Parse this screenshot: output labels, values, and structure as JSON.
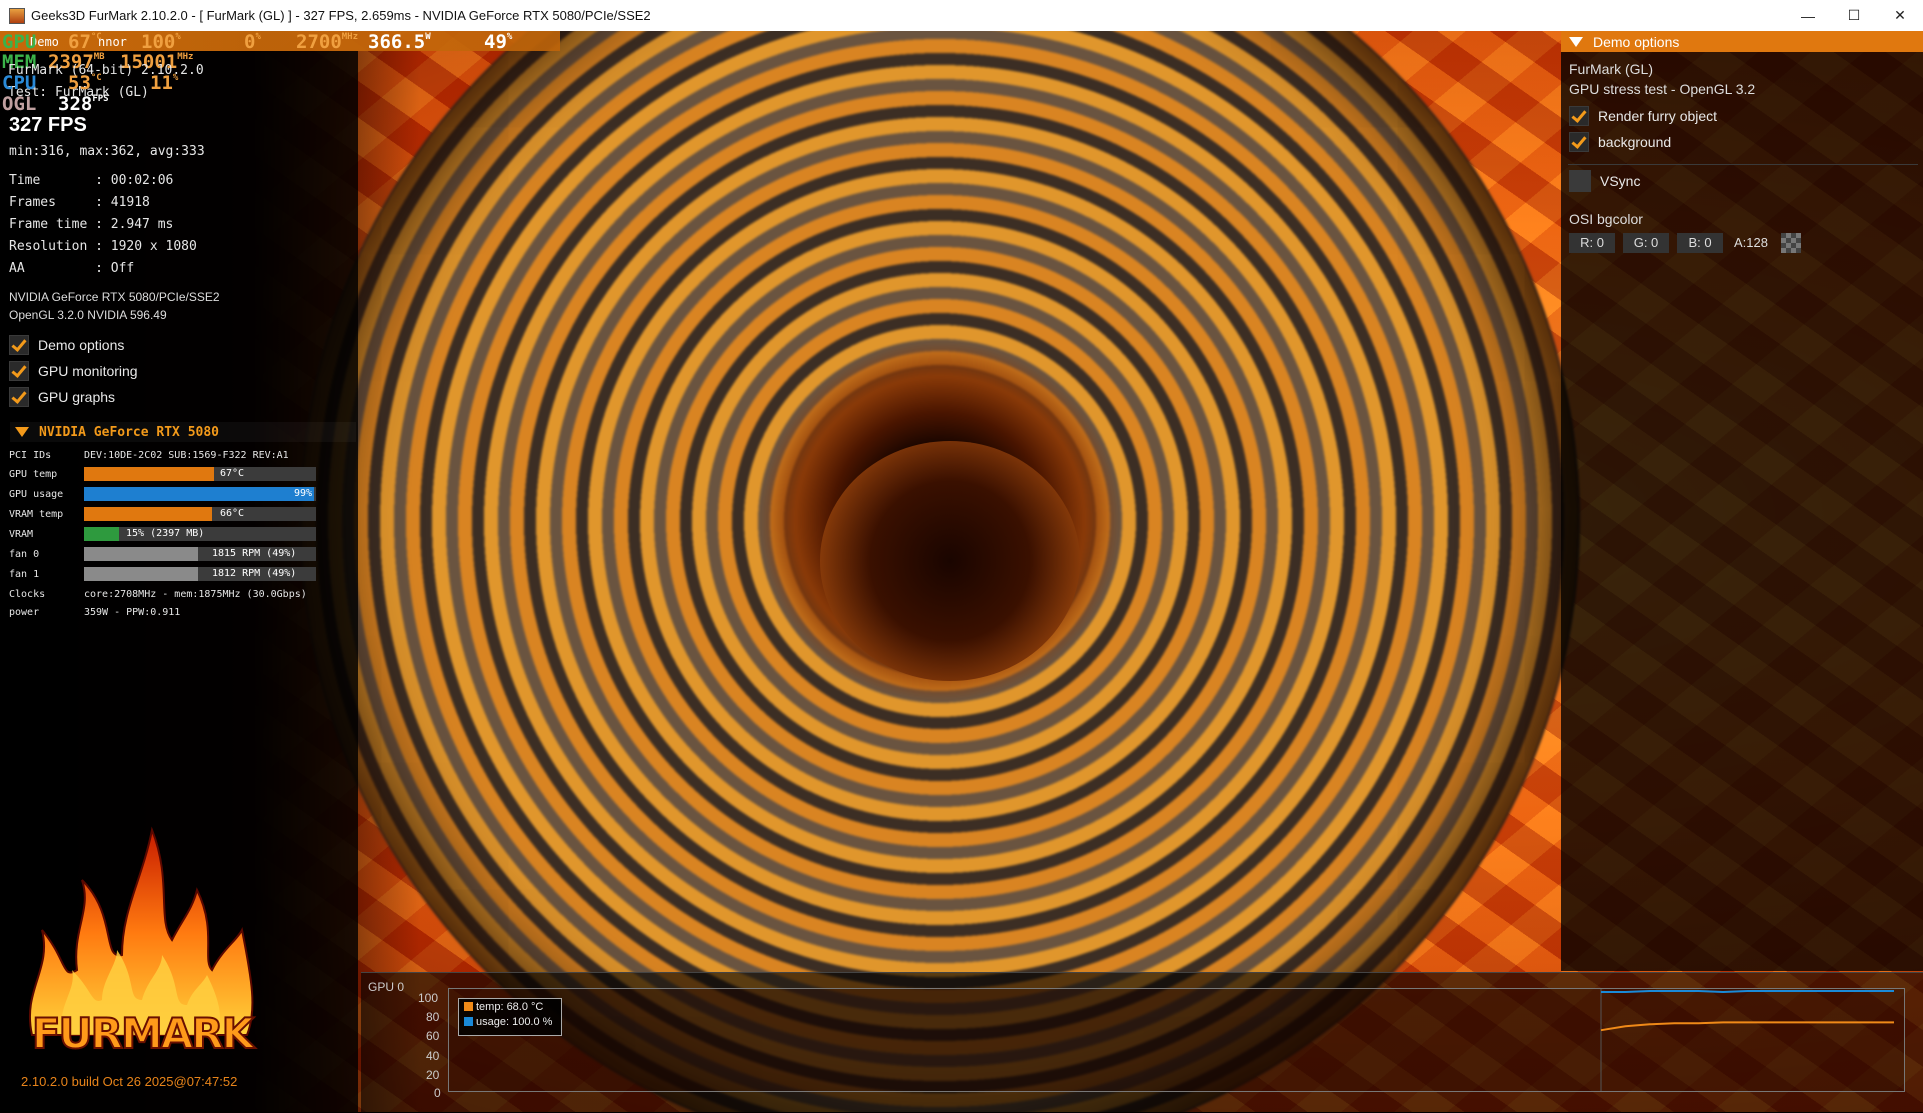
{
  "window": {
    "title": "Geeks3D FurMark 2.10.2.0 - [ FurMark (GL) ] - 327 FPS, 2.659ms - NVIDIA GeForce RTX 5080/PCIe/SSE2",
    "minimize": "—",
    "maximize": "☐",
    "close": "✕"
  },
  "osd": {
    "gpu_label": "GPU",
    "gpu_temp": "67",
    "gpu_temp_unit": "°C",
    "gpu_usage": "100",
    "gpu_usage_unit": "%",
    "gpu_x": "0",
    "gpu_x_unit": "%",
    "gpu_clock": "2700",
    "gpu_clock_unit": "MHz",
    "gpu_power": "366.5",
    "gpu_power_unit": "W",
    "gpu_fan": "49",
    "gpu_fan_unit": "%",
    "mem_label": "MEM",
    "mem_used": "2397",
    "mem_used_unit": "MB",
    "mem_clock": "15001",
    "mem_clock_unit": "MHz",
    "cpu_label": "CPU",
    "cpu_temp": "53",
    "cpu_temp_unit": "°C",
    "cpu_usage": "11",
    "cpu_usage_unit": "%",
    "ogl_label": "OGL",
    "ogl_fps": "328",
    "ogl_fps_unit": "FPS",
    "under_demo": "Demo",
    "under_motor": "nnor"
  },
  "info": {
    "version_line": "FurMark (64-bit) 2.10.2.0",
    "test_line": "Test: FurMark (GL)",
    "fps": "327 FPS",
    "stats": "min:316, max:362, avg:333",
    "time": "Time       : 00:02:06",
    "frames": "Frames     : 41918",
    "frame_time": "Frame time : 2.947 ms",
    "resolution": "Resolution : 1920 x 1080",
    "aa": "AA         : Off",
    "renderer": "NVIDIA GeForce RTX 5080/PCIe/SSE2",
    "opengl": "OpenGL 3.2.0 NVIDIA 596.49"
  },
  "toggles": {
    "demo_options": "Demo options",
    "gpu_monitoring": "GPU monitoring",
    "gpu_graphs": "GPU graphs"
  },
  "gpu_section": {
    "title": "NVIDIA GeForce RTX 5080",
    "pci_label": "PCI IDs",
    "pci_value": "DEV:10DE-2C02 SUB:1569-F322 REV:A1",
    "gpu_temp_label": "GPU temp",
    "gpu_temp_text": "67°C",
    "gpu_temp_level": 0.56,
    "gpu_usage_label": "GPU usage",
    "gpu_usage_text": "99%",
    "gpu_usage_level": 0.99,
    "vram_temp_label": "VRAM temp",
    "vram_temp_text": "66°C",
    "vram_temp_level": 0.55,
    "vram_label": "VRAM",
    "vram_text": "15% (2397 MB)",
    "vram_level": 0.15,
    "fan0_label": "fan 0",
    "fan0_text": "1815 RPM (49%)",
    "fan0_level": 0.49,
    "fan1_label": "fan 1",
    "fan1_text": "1812 RPM (49%)",
    "fan1_level": 0.49,
    "clocks_label": "Clocks",
    "clocks_value": "core:2708MHz - mem:1875MHz (30.0Gbps)",
    "power_label": "power",
    "power_value": "359W - PPW:0.911"
  },
  "demo_panel": {
    "header": "Demo options",
    "name": "FurMark (GL)",
    "desc": "GPU stress test - OpenGL 3.2",
    "render_furry": "Render furry object",
    "background": "background",
    "vsync": "VSync",
    "osi_bgcolor": "OSI bgcolor",
    "r": "R: 0",
    "g": "G: 0",
    "b": "B: 0",
    "a": "A:128"
  },
  "graph": {
    "title": "GPU 0",
    "legend_temp": "temp: 68.0 °C",
    "legend_usage": "usage: 100.0 %",
    "yticks": [
      "100",
      "80",
      "60",
      "40",
      "20",
      "0"
    ]
  },
  "logo": {
    "wordmark": "FURMARK",
    "build": "2.10.2.0 build Oct 26 2025@07:47:52"
  },
  "chart_data": {
    "type": "line",
    "ylim": [
      0,
      100
    ],
    "series": [
      {
        "name": "temp: 68.0 °C",
        "color": "#f08a18",
        "values": [
          60,
          64,
          66,
          67,
          67,
          68,
          68,
          68,
          68,
          68,
          68,
          68,
          68
        ]
      },
      {
        "name": "usage: 100.0 %",
        "color": "#1a8ad8",
        "values": [
          99,
          99,
          100,
          100,
          100,
          99,
          100,
          100,
          100,
          100,
          100,
          100,
          100
        ]
      }
    ]
  },
  "colors": {
    "accent": "#f39a1a",
    "usage_bar": "#1e7fd0",
    "vram_bar": "#2e9a3e",
    "fan_bar": "#8a8a8a"
  }
}
